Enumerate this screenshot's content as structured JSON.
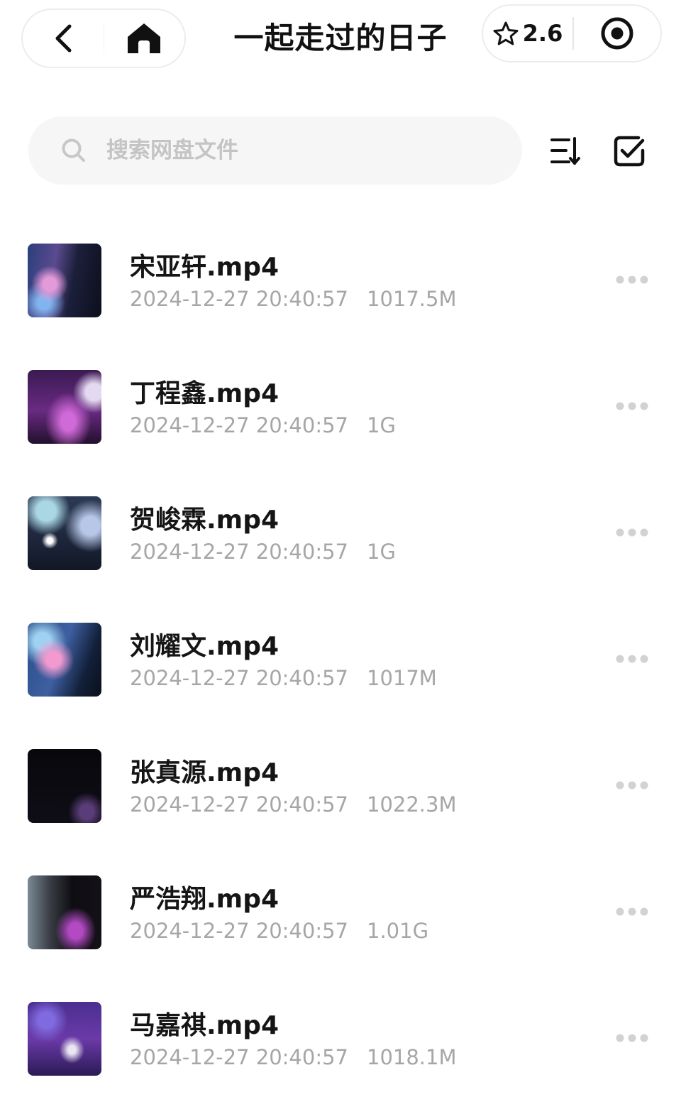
{
  "header": {
    "title": "一起走过的日子",
    "back_icon": "back-arrow-icon",
    "home_icon": "home-icon",
    "rating": "2.6",
    "rating_icon": "star-outline-icon",
    "record_icon": "target-record-icon"
  },
  "search": {
    "placeholder": "搜索网盘文件",
    "value": "",
    "icon": "search-icon"
  },
  "toolbar": {
    "sort_icon": "sort-icon",
    "select_icon": "checkbox-icon"
  },
  "files": [
    {
      "name": "宋亚轩.mp4",
      "date": "2024-12-27 20:40:57",
      "size": "1017.5M"
    },
    {
      "name": "丁程鑫.mp4",
      "date": "2024-12-27 20:40:57",
      "size": "1G"
    },
    {
      "name": "贺峻霖.mp4",
      "date": "2024-12-27 20:40:57",
      "size": "1G"
    },
    {
      "name": "刘耀文.mp4",
      "date": "2024-12-27 20:40:57",
      "size": "1017M"
    },
    {
      "name": "张真源.mp4",
      "date": "2024-12-27 20:40:57",
      "size": "1022.3M"
    },
    {
      "name": "严浩翔.mp4",
      "date": "2024-12-27 20:40:57",
      "size": "1.01G"
    },
    {
      "name": "马嘉祺.mp4",
      "date": "2024-12-27 20:40:57",
      "size": "1018.1M"
    }
  ],
  "colors": {
    "text_primary": "#151515",
    "text_secondary": "#a6a6a6",
    "search_bg": "#f6f6f6",
    "placeholder": "#c4c4c4"
  }
}
